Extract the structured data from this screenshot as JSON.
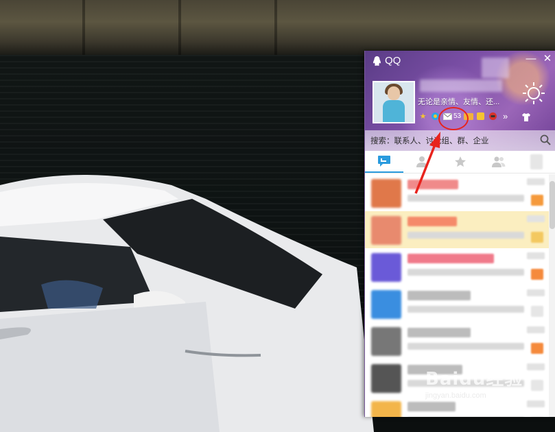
{
  "window": {
    "app_name": "QQ"
  },
  "profile": {
    "signature": "无论是亲情、友情、还...",
    "mail_count": "53"
  },
  "search": {
    "placeholder": "搜索：联系人、讨论组、群、企业"
  },
  "tabs": [
    {
      "icon": "conversation-icon",
      "active": true
    },
    {
      "icon": "contacts-icon",
      "active": false
    },
    {
      "icon": "favorites-star-icon",
      "active": false
    },
    {
      "icon": "group-icon",
      "active": false
    }
  ],
  "conversations": [
    {
      "avatar_color": "#e0784a",
      "name_color": "#f08a8a",
      "tag_color": "#f59a3c",
      "selected": false
    },
    {
      "avatar_color": "#e88a6e",
      "name_color": "#f58a6a",
      "tag_color": "#f3c860",
      "selected": true
    },
    {
      "avatar_color": "#6a5ad8",
      "name_color": "#f07a8a",
      "tag_color": "#f58a3c",
      "selected": false
    },
    {
      "avatar_color": "#3a8ee0",
      "name_color": "#bcbcbc",
      "tag_color": "#e6e6e6",
      "selected": false
    },
    {
      "avatar_color": "#777777",
      "name_color": "#bcbcbc",
      "tag_color": "#f58a3c",
      "selected": false
    },
    {
      "avatar_color": "#555555",
      "name_color": "#bcbcbc",
      "tag_color": "#e6e6e6",
      "selected": false
    },
    {
      "avatar_color": "#f3b54a",
      "name_color": "#bcbcbc",
      "tag_color": "#e6e6e6",
      "selected": false
    }
  ],
  "colors": {
    "accent": "#2a9bde",
    "annotation_red": "#e8231d",
    "header_purple": "#7b4fa6"
  },
  "watermark": {
    "brand": "Baidu经验",
    "url": "jingyan.baidu.com"
  }
}
